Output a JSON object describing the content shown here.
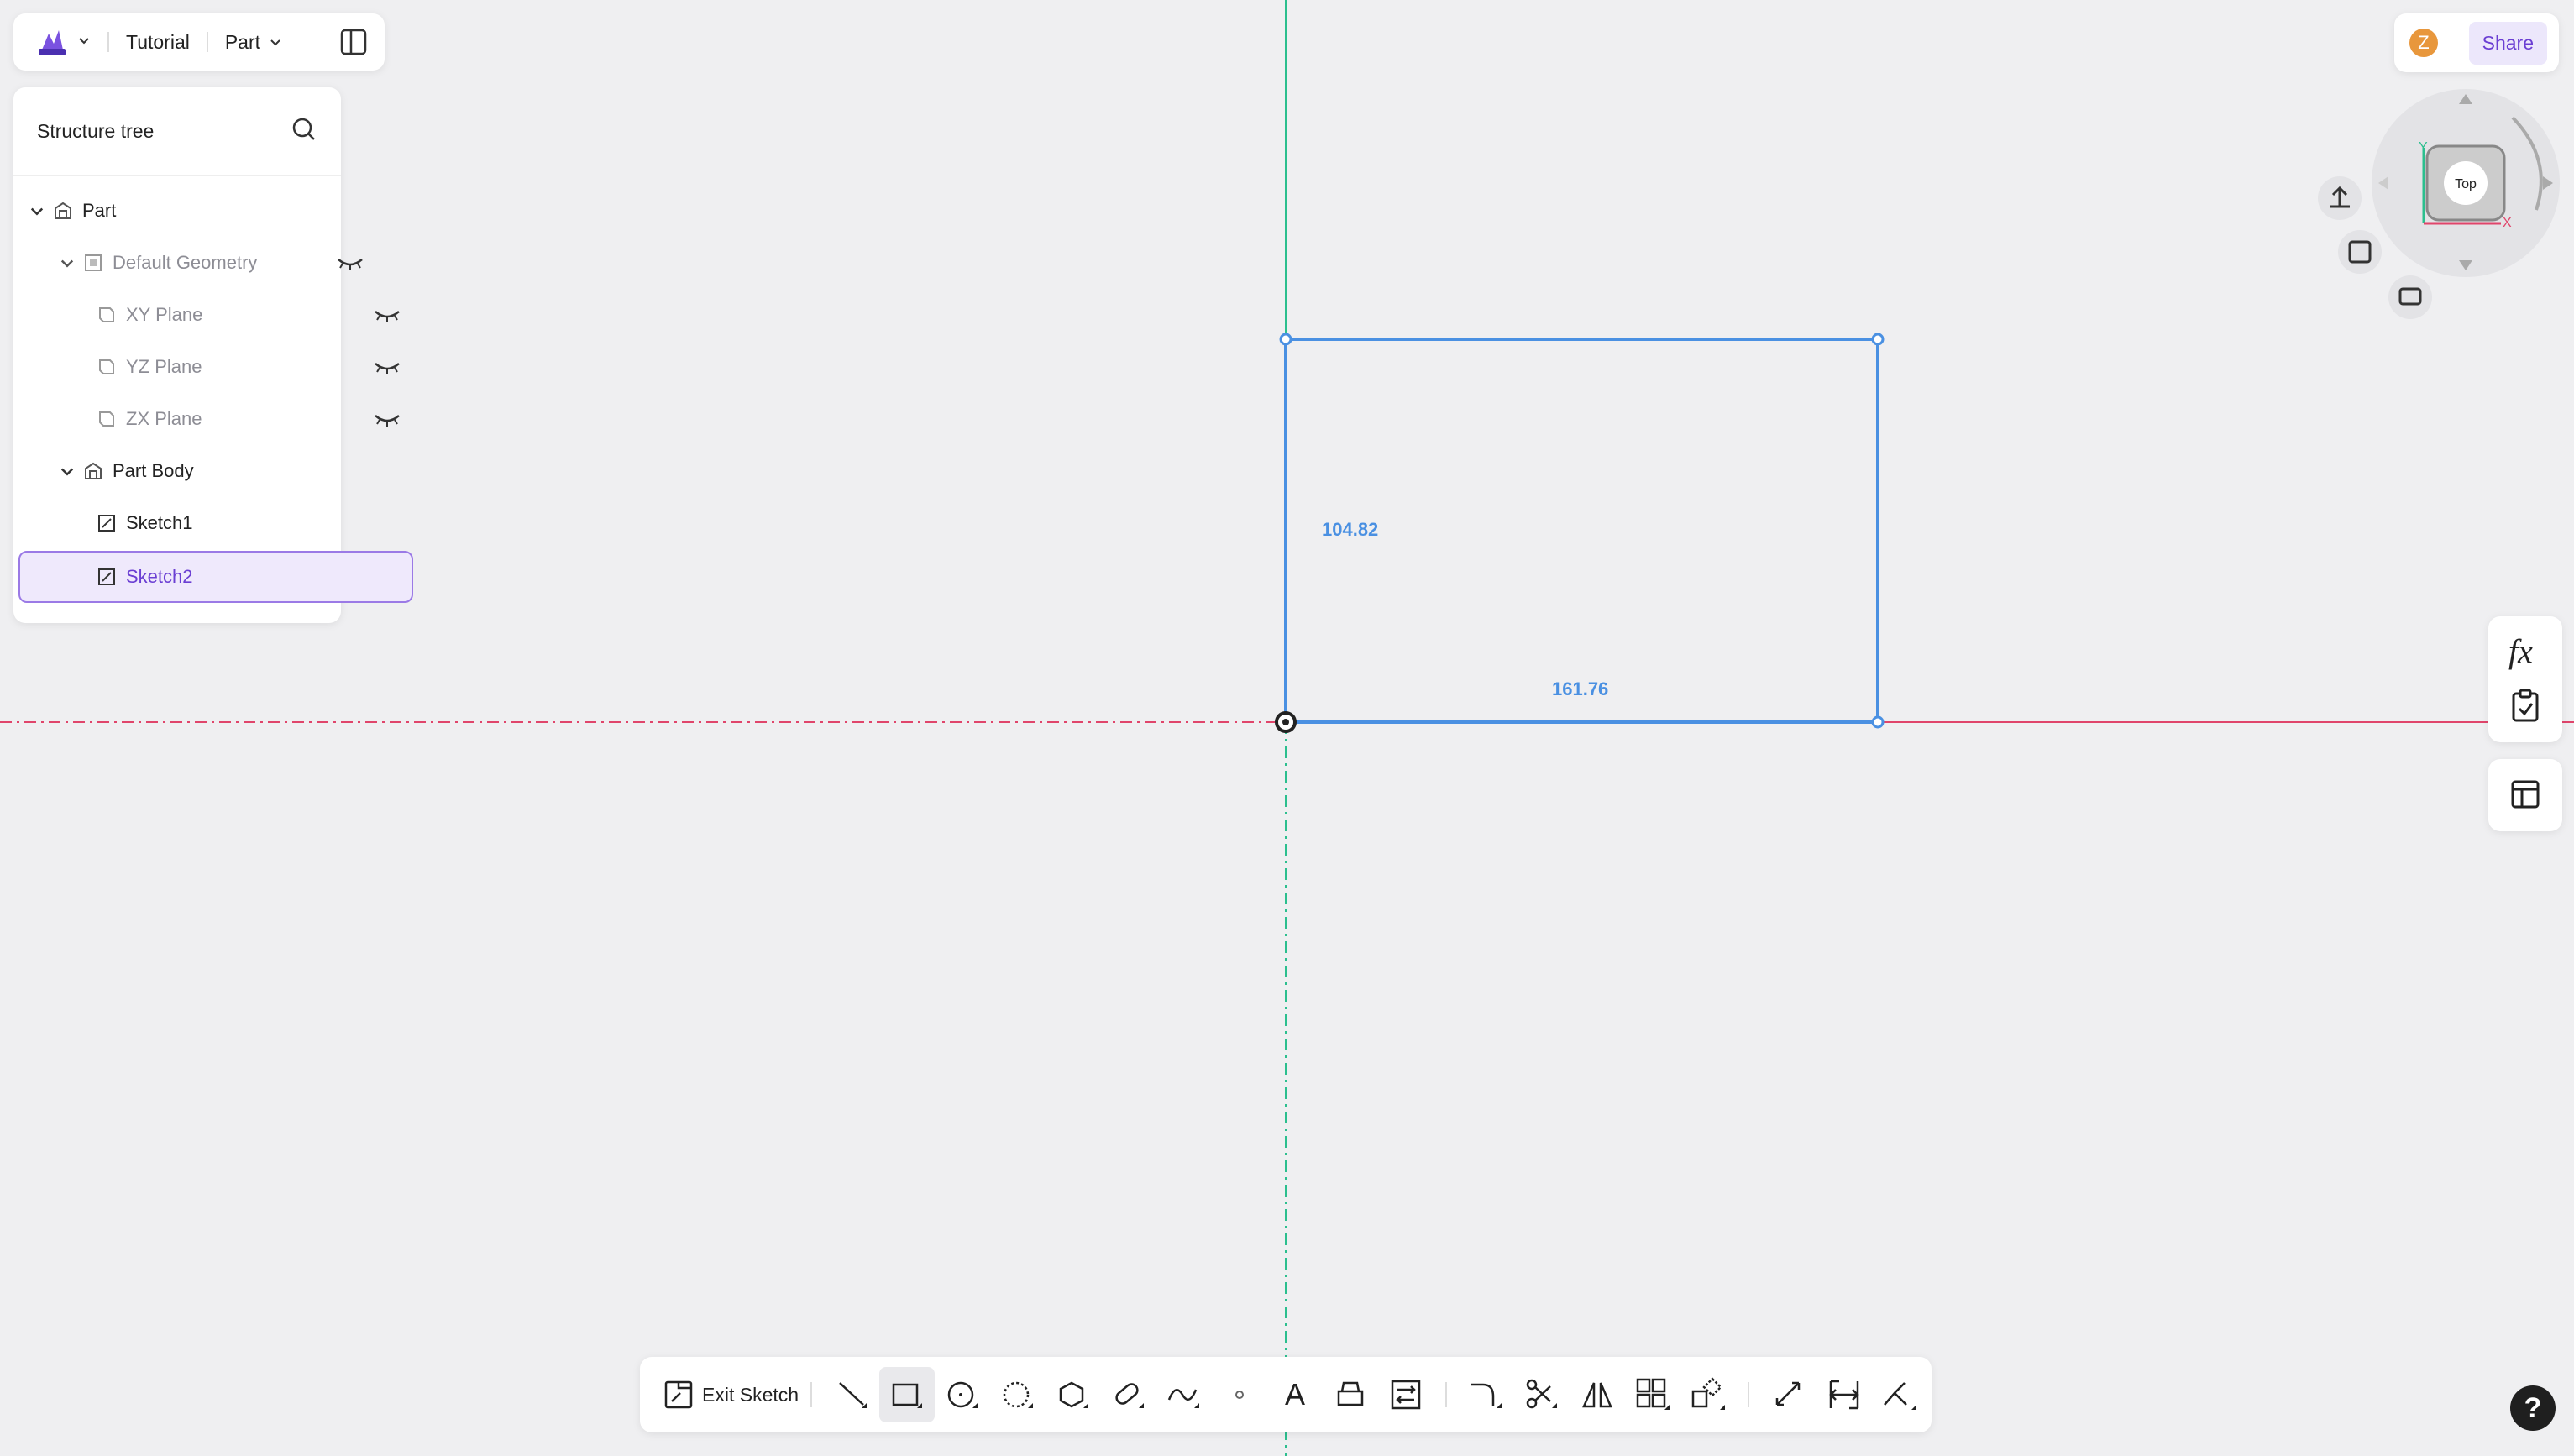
{
  "header": {
    "title": "Tutorial",
    "mode": "Part"
  },
  "tree": {
    "title": "Structure tree",
    "items": [
      {
        "label": "Part"
      },
      {
        "label": "Default Geometry"
      },
      {
        "label": "XY Plane"
      },
      {
        "label": "YZ Plane"
      },
      {
        "label": "ZX Plane"
      },
      {
        "label": "Part Body"
      },
      {
        "label": "Sketch1"
      },
      {
        "label": "Sketch2"
      }
    ]
  },
  "sketch": {
    "height_dim": "104.82",
    "width_dim": "161.76"
  },
  "share": {
    "avatar_letter": "Z",
    "label": "Share"
  },
  "viewcube": {
    "face_label": "Top",
    "axis_y": "Y",
    "axis_x": "X"
  },
  "right_tools": {
    "fx_label": "fx"
  },
  "toolbar": {
    "exit_label": "Exit Sketch",
    "text_tool_label": "A"
  },
  "help_label": "?",
  "colors": {
    "accent": "#6b3fd3",
    "sketch_line": "#4a90e2",
    "y_axis": "#2bbf8e",
    "x_axis": "#e0456b"
  }
}
